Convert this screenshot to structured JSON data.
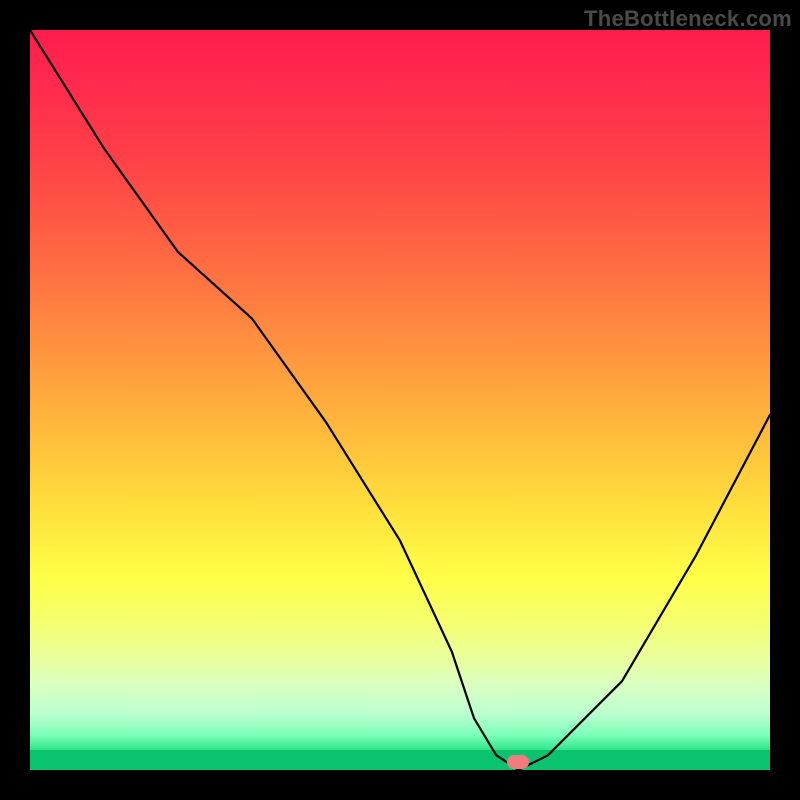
{
  "watermark": "TheBottleneck.com",
  "chart_data": {
    "type": "line",
    "title": "",
    "xlabel": "",
    "ylabel": "",
    "xlim": [
      0,
      100
    ],
    "ylim": [
      0,
      100
    ],
    "x": [
      0,
      5,
      10,
      20,
      30,
      40,
      50,
      57,
      60,
      63,
      66,
      70,
      80,
      90,
      100
    ],
    "values": [
      100,
      92,
      84,
      70,
      61,
      47,
      31,
      16,
      7,
      2,
      0,
      2,
      12,
      29,
      48
    ],
    "marker": {
      "x": 66,
      "y": 0,
      "color": "#f07c7d"
    },
    "gradient_colors": {
      "top": "#ff1c4d",
      "mid": "#ffde3c",
      "bottom": "#09c36e"
    }
  }
}
